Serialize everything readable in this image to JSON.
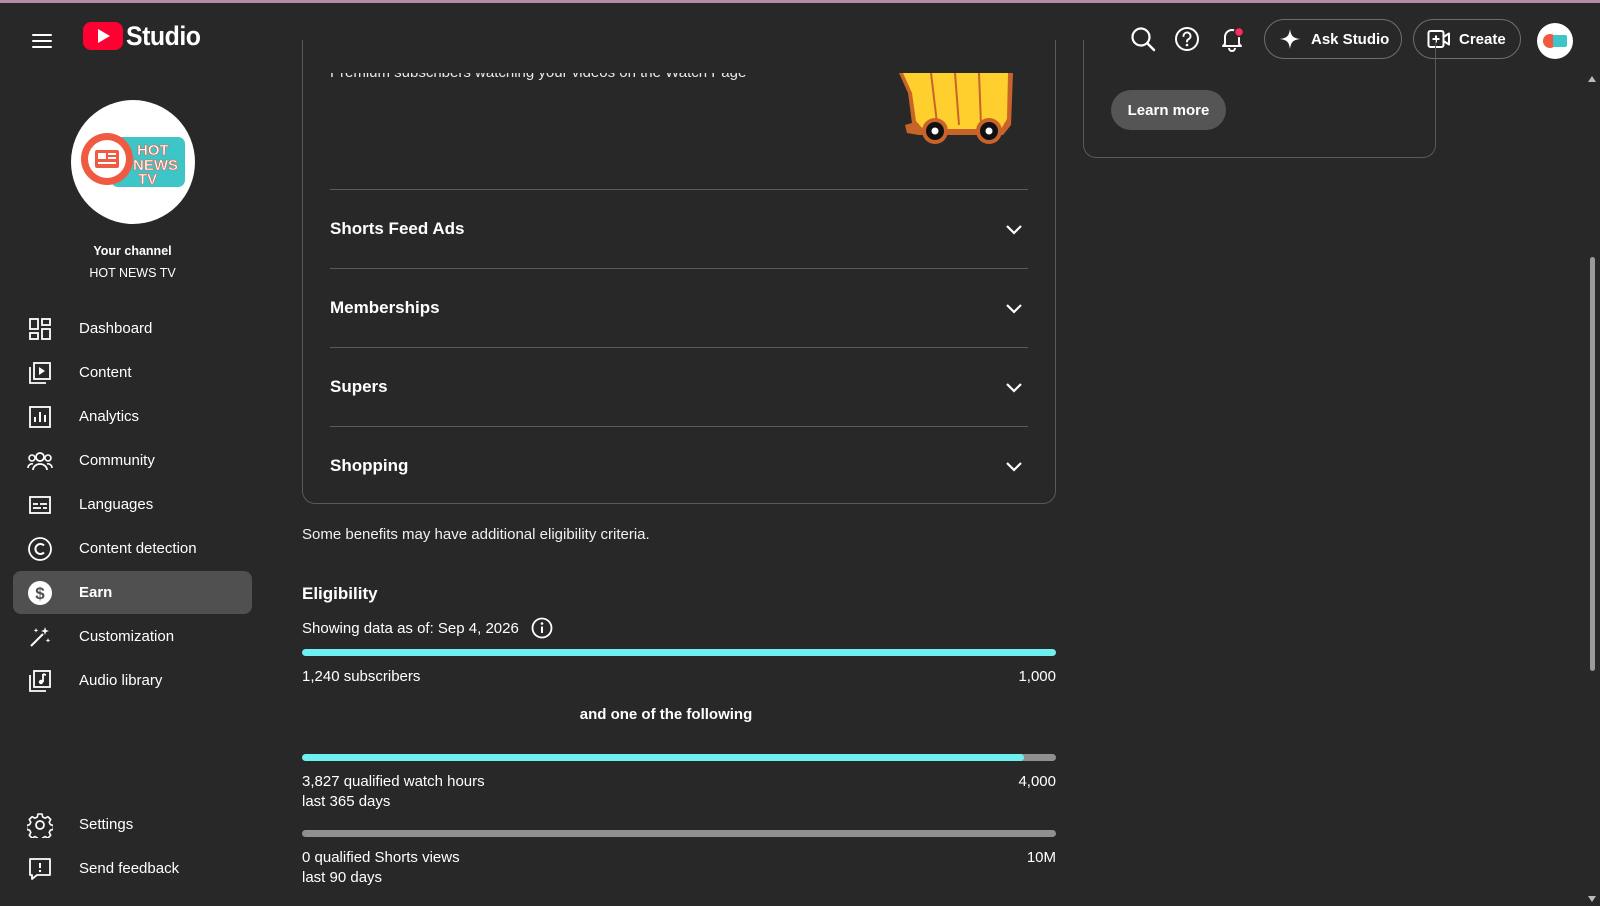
{
  "header": {
    "app_name": "Studio",
    "ask_studio_label": "Ask Studio",
    "create_label": "Create"
  },
  "sidebar": {
    "your_channel_label": "Your channel",
    "channel_name": "HOT NEWS TV",
    "logo_text_lines": [
      "HOT",
      "NEWS",
      "TV"
    ],
    "items": [
      {
        "label": "Dashboard",
        "icon": "dashboard-icon"
      },
      {
        "label": "Content",
        "icon": "content-icon"
      },
      {
        "label": "Analytics",
        "icon": "analytics-icon"
      },
      {
        "label": "Community",
        "icon": "community-icon"
      },
      {
        "label": "Languages",
        "icon": "languages-icon"
      },
      {
        "label": "Content detection",
        "icon": "copyright-icon"
      },
      {
        "label": "Earn",
        "icon": "dollar-icon",
        "active": true
      },
      {
        "label": "Customization",
        "icon": "magic-wand-icon"
      },
      {
        "label": "Audio library",
        "icon": "audio-library-icon"
      }
    ],
    "footer_items": [
      {
        "label": "Settings",
        "icon": "gear-icon"
      },
      {
        "label": "Send feedback",
        "icon": "feedback-icon"
      }
    ]
  },
  "main": {
    "premium_text": "Premium subscribers watching your videos on the Watch Page",
    "accordions": [
      "Shorts Feed Ads",
      "Memberships",
      "Supers",
      "Shopping"
    ],
    "note": "Some benefits may have additional eligibility criteria.",
    "eligibility": {
      "title": "Eligibility",
      "date_text": "Showing data as of: Sep 4, 2026",
      "or_label": "and one of the following",
      "requirements": [
        {
          "label": "1,240 subscribers",
          "sublabel": "",
          "target": "1,000",
          "progress": 1.0
        },
        {
          "label": "3,827 qualified watch hours",
          "sublabel": "last 365 days",
          "target": "4,000",
          "progress": 0.957
        },
        {
          "label": "0 qualified Shorts views",
          "sublabel": "last 90 days",
          "target": "10M",
          "progress": 0.0
        }
      ]
    }
  },
  "right_card": {
    "learn_more_label": "Learn more"
  },
  "colors": {
    "background": "#282828",
    "progress": "#6ff0f0",
    "brand_red": "#ff0033",
    "active_nav": "#505050"
  }
}
